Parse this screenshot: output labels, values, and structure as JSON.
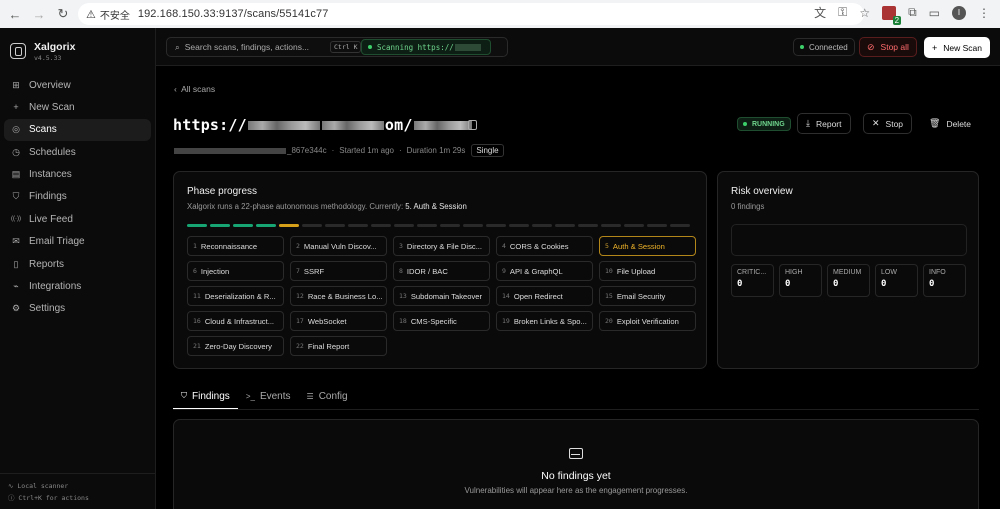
{
  "browser": {
    "insecure_label": "不安全",
    "url": "192.168.150.33:9137/scans/55141c77",
    "ext_count": "2",
    "ext_count2": "9",
    "profile_initial": "I"
  },
  "brand": {
    "name": "Xalgorix",
    "version": "v4.5.33"
  },
  "sidebar": {
    "items": [
      {
        "label": "Overview",
        "icon": "grid-icon"
      },
      {
        "label": "New Scan",
        "icon": "plus-icon"
      },
      {
        "label": "Scans",
        "icon": "radar-icon"
      },
      {
        "label": "Schedules",
        "icon": "clock-icon"
      },
      {
        "label": "Instances",
        "icon": "server-icon"
      },
      {
        "label": "Findings",
        "icon": "shield-icon"
      },
      {
        "label": "Live Feed",
        "icon": "broadcast-icon"
      },
      {
        "label": "Email Triage",
        "icon": "mail-icon"
      },
      {
        "label": "Reports",
        "icon": "document-icon"
      },
      {
        "label": "Integrations",
        "icon": "plug-icon"
      },
      {
        "label": "Settings",
        "icon": "gear-icon"
      }
    ],
    "active_index": 2,
    "footer_line1": "Local scanner",
    "footer_line2": "Ctrl+K for actions"
  },
  "topbar": {
    "search_placeholder": "Search scans, findings, actions...",
    "search_shortcut": "Ctrl K",
    "scanning_label": "Scanning https://",
    "connected_label": "Connected",
    "stop_all_label": "Stop all",
    "new_scan_label": "New Scan"
  },
  "scan": {
    "back_label": "All scans",
    "url_prefix": "https://",
    "url_mid": "om/",
    "id_suffix": "_867e344c",
    "started": "Started 1m ago",
    "duration": "Duration 1m 29s",
    "mode": "Single",
    "status": "RUNNING",
    "report_label": "Report",
    "stop_label": "Stop",
    "delete_label": "Delete"
  },
  "phase_progress": {
    "title": "Phase progress",
    "subtitle_prefix": "Xalgorix runs a 22-phase autonomous methodology. Currently:",
    "current": "5. Auth & Session",
    "total_phases": 22,
    "completed_phases": 4,
    "current_phase_number": 5,
    "phases": [
      {
        "n": "1",
        "label": "Reconnaissance"
      },
      {
        "n": "2",
        "label": "Manual Vuln Discov..."
      },
      {
        "n": "3",
        "label": "Directory & File Disc..."
      },
      {
        "n": "4",
        "label": "CORS & Cookies"
      },
      {
        "n": "5",
        "label": "Auth & Session"
      },
      {
        "n": "6",
        "label": "Injection"
      },
      {
        "n": "7",
        "label": "SSRF"
      },
      {
        "n": "8",
        "label": "IDOR / BAC"
      },
      {
        "n": "9",
        "label": "API & GraphQL"
      },
      {
        "n": "10",
        "label": "File Upload"
      },
      {
        "n": "11",
        "label": "Deserialization & R..."
      },
      {
        "n": "12",
        "label": "Race & Business Lo..."
      },
      {
        "n": "13",
        "label": "Subdomain Takeover"
      },
      {
        "n": "14",
        "label": "Open Redirect"
      },
      {
        "n": "15",
        "label": "Email Security"
      },
      {
        "n": "16",
        "label": "Cloud & Infrastruct..."
      },
      {
        "n": "17",
        "label": "WebSocket"
      },
      {
        "n": "18",
        "label": "CMS-Specific"
      },
      {
        "n": "19",
        "label": "Broken Links & Spo..."
      },
      {
        "n": "20",
        "label": "Exploit Verification"
      },
      {
        "n": "21",
        "label": "Zero-Day Discovery"
      },
      {
        "n": "22",
        "label": "Final Report"
      }
    ]
  },
  "risk": {
    "title": "Risk overview",
    "findings_count": "0 findings",
    "severities": [
      {
        "label": "CRITIC...",
        "value": "0"
      },
      {
        "label": "HIGH",
        "value": "0"
      },
      {
        "label": "MEDIUM",
        "value": "0"
      },
      {
        "label": "LOW",
        "value": "0"
      },
      {
        "label": "INFO",
        "value": "0"
      }
    ]
  },
  "tabs": [
    {
      "label": "Findings",
      "icon": "shield-icon"
    },
    {
      "label": "Events",
      "icon": "terminal-icon"
    },
    {
      "label": "Config",
      "icon": "sliders-icon"
    }
  ],
  "empty_state": {
    "title": "No findings yet",
    "subtitle": "Vulnerabilities will appear here as the engagement progresses."
  },
  "colors": {
    "accent_green": "#3ccf6a",
    "current_phase": "#f0b429",
    "danger": "#ff6b6b"
  }
}
